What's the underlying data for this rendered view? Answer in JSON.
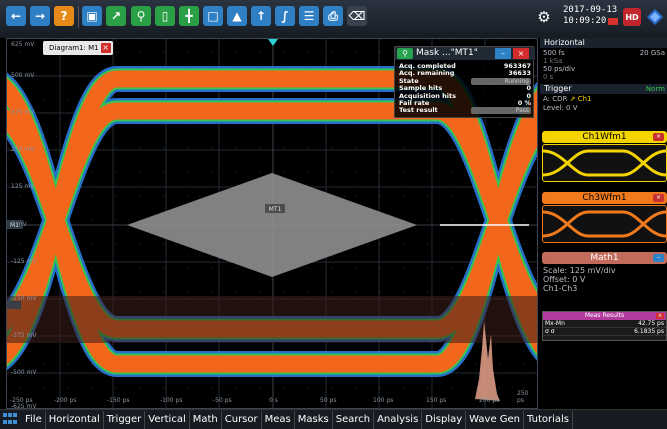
{
  "toolbar": {
    "buttons": [
      "back-icon",
      "forward-icon",
      "help-icon",
      "open-folder-icon",
      "autoscale-icon",
      "zoom-icon",
      "histogram-icon",
      "cursor-grid-icon",
      "zoom-window-icon",
      "chart-icon",
      "marker-icon",
      "fft-icon",
      "history-icon",
      "print-icon",
      "delete-icon"
    ],
    "date": "2017-09-13",
    "time": "10:09:20",
    "hd_label": "HD"
  },
  "diagram": {
    "tab_label": "Diagram1: M1",
    "y_labels": [
      "625 mV",
      "500 mV",
      "375 mV",
      "250 mV",
      "125 mV",
      "0 mV",
      "-125 mV",
      "-250 mV",
      "-375 mV",
      "-500 mV",
      "-625 mV"
    ],
    "x_labels": [
      "-250 ps",
      "-200 ps",
      "-150 ps",
      "-100 ps",
      "-50 ps",
      "0 s",
      "50 ps",
      "100 ps",
      "150 ps",
      "200 ps",
      "250 ps"
    ],
    "m1_label": "M1",
    "mt1_label": "MT1",
    "colors": {
      "eye_orange": "#f2671c",
      "eye_green": "#35c553",
      "eye_blue": "#2c7be0",
      "mask_gray": "#8c8c8c"
    }
  },
  "mask_window": {
    "title": "Mask ...\"MT1\"",
    "rows": [
      {
        "label": "Acq. completed",
        "value": "963367"
      },
      {
        "label": "Acq. remaining",
        "value": "36633"
      },
      {
        "label": "State",
        "value": "Running"
      },
      {
        "label": "Sample hits",
        "value": "0"
      },
      {
        "label": "Acquisition hits",
        "value": "0"
      },
      {
        "label": "Fail rate",
        "value": "0 %"
      },
      {
        "label": "Test result",
        "value": "Pass"
      }
    ]
  },
  "panel": {
    "horizontal": {
      "title": "Horizontal",
      "rows": [
        "500 fs",
        "1 kSa",
        "50 ps/div",
        "0 s"
      ],
      "rate": "20 GSa"
    },
    "trigger": {
      "title": "Trigger",
      "mode": "Norm",
      "source_line": "A:   CDR",
      "channel": "Ch1",
      "level": "Level: 0 V"
    },
    "waveforms": [
      {
        "name": "Ch1Wfm1",
        "color": "#f3d400"
      },
      {
        "name": "Ch3Wfm1",
        "color": "#f07a1c"
      }
    ],
    "math": {
      "title": "Math1",
      "lines": [
        "Scale: 125 mV/div",
        "Offset: 0 V",
        "Ch1-Ch3"
      ]
    },
    "meas": {
      "title": "Meas Results",
      "rows": [
        {
          "label": "Mx-Mn",
          "value": "42.75 ps"
        },
        {
          "label": "σ σ",
          "value": "6.1835 ps"
        }
      ]
    }
  },
  "menu": [
    "File",
    "Horizontal",
    "Trigger",
    "Vertical",
    "Math",
    "Cursor",
    "Meas",
    "Masks",
    "Search",
    "Analysis",
    "Display",
    "Wave Gen",
    "Tutorials"
  ]
}
